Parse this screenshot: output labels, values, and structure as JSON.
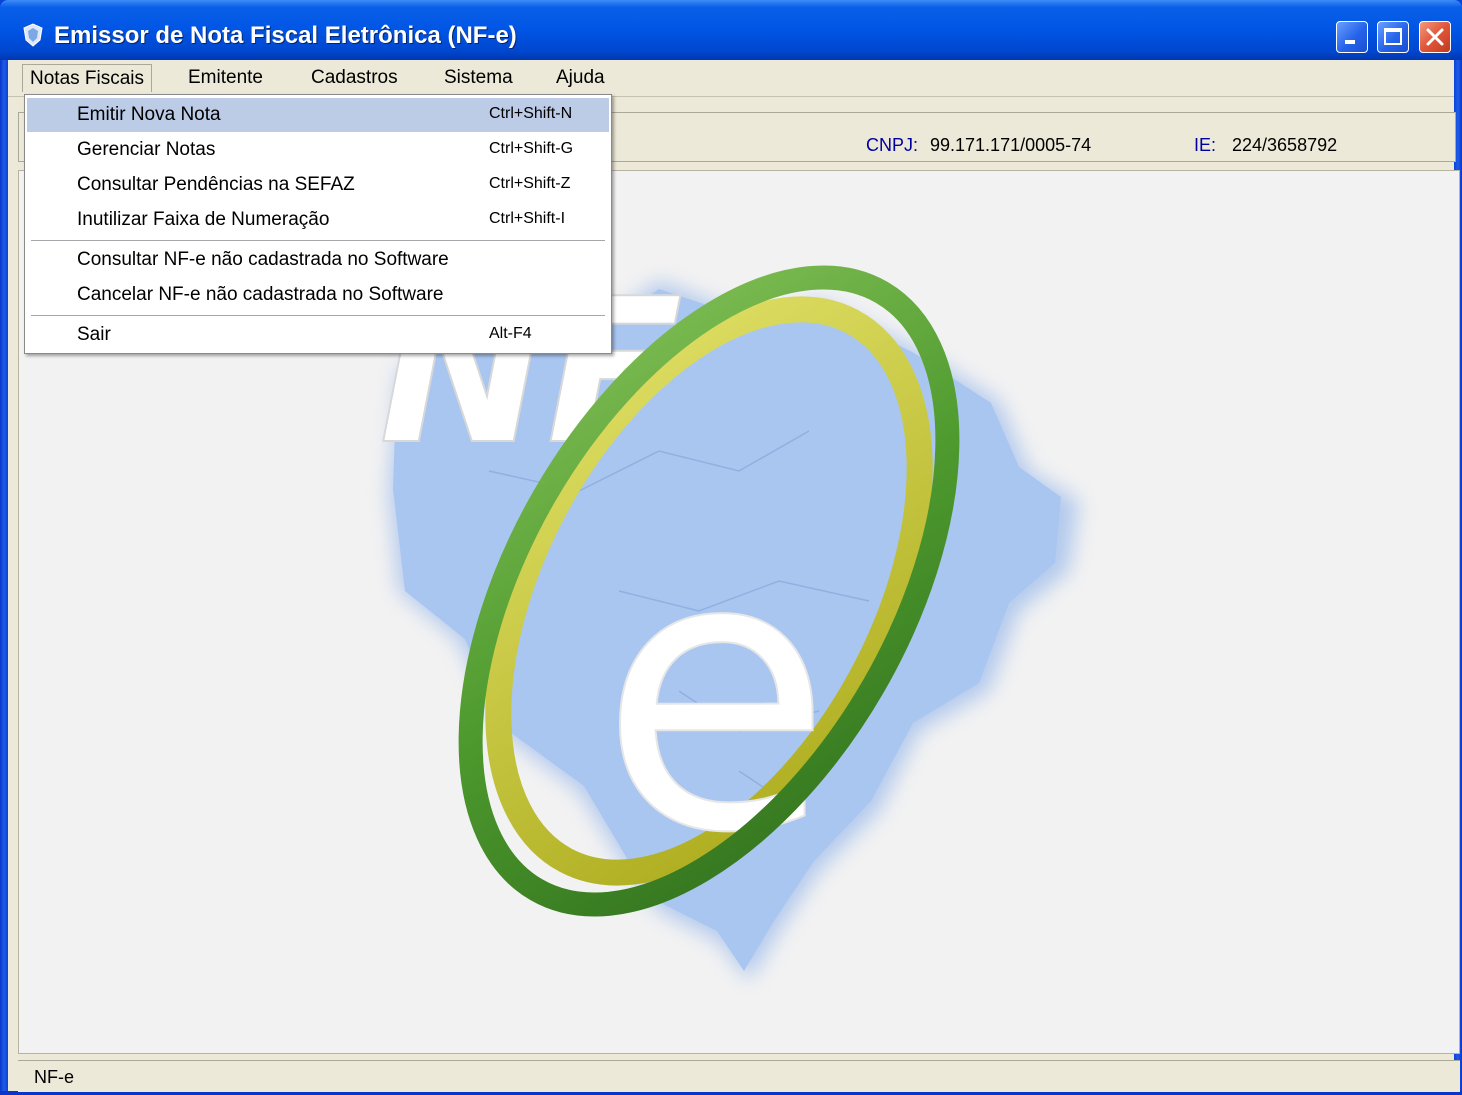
{
  "window": {
    "title": "Emissor de Nota Fiscal Eletrônica (NF-e)"
  },
  "menubar": {
    "items": [
      {
        "label": "Notas Fiscais"
      },
      {
        "label": "Emitente"
      },
      {
        "label": "Cadastros"
      },
      {
        "label": "Sistema"
      },
      {
        "label": "Ajuda"
      }
    ]
  },
  "dropdown": {
    "items": [
      {
        "label": "Emitir Nova Nota",
        "shortcut": "Ctrl+Shift-N"
      },
      {
        "label": "Gerenciar Notas",
        "shortcut": "Ctrl+Shift-G"
      },
      {
        "label": "Consultar Pendências na SEFAZ",
        "shortcut": "Ctrl+Shift-Z"
      },
      {
        "label": "Inutilizar Faixa de Numeração",
        "shortcut": "Ctrl+Shift-I"
      },
      {
        "label": "Consultar NF-e não cadastrada no Software",
        "shortcut": ""
      },
      {
        "label": "Cancelar NF-e não cadastrada no Software",
        "shortcut": ""
      },
      {
        "label": "Sair",
        "shortcut": "Alt-F4"
      }
    ],
    "highlighted_index": 0
  },
  "emitente": {
    "cnpj_label": "CNPJ:",
    "cnpj_value": "99.171.171/0005-74",
    "ie_label": "IE:",
    "ie_value": "224/3658792"
  },
  "logo": {
    "text_nf": "NF",
    "text_e": "e",
    "map_color": "#a9c6f0",
    "ring_green": "#4e9a2e",
    "ring_yellow": "#c7c72a"
  },
  "statusbar": {
    "text": "NF-e"
  },
  "colors": {
    "titlebar": "#0055e5",
    "chrome": "#ece9d8",
    "highlight": "#bccbe6",
    "label_blue": "#0000a0"
  }
}
